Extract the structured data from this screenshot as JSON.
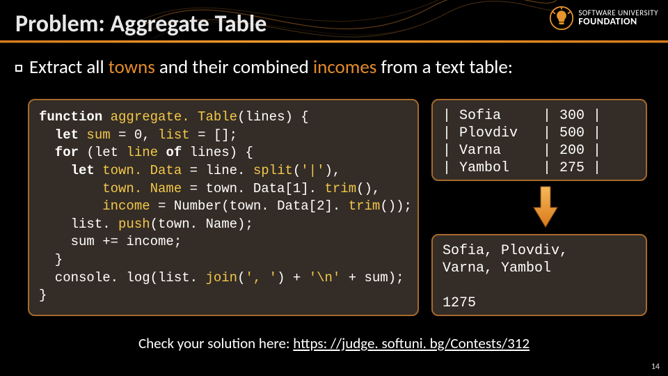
{
  "logo": {
    "line1": "SOFTWARE UNIVERSITY",
    "line2": "FOUNDATION"
  },
  "title": "Problem: Aggregate Table",
  "bullet": {
    "pre": "Extract all ",
    "a1": "towns",
    "mid": " and their combined ",
    "a2": "incomes",
    "post": " from a text table:"
  },
  "code": {
    "l1a": "function ",
    "l1b": "aggregate. Table",
    "l1c": "(lines) {",
    "l2a": "  let ",
    "l2b": "sum ",
    "l2c": "= 0, ",
    "l2d": "list ",
    "l2e": "= [];",
    "l3a": "  for ",
    "l3b": "(let ",
    "l3c": "line ",
    "l3d": "of ",
    "l3e": "lines) {",
    "l4a": "    let ",
    "l4b": "town. Data ",
    "l4c": "= line. ",
    "l4d": "split",
    "l4e": "(",
    "l4f": "'|'",
    "l4g": "),",
    "l5a": "        ",
    "l5b": "town. Name ",
    "l5c": "= town. Data[1]. ",
    "l5d": "trim",
    "l5e": "(),",
    "l6a": "        ",
    "l6b": "income ",
    "l6c": "= Number(town. Data[2]. ",
    "l6d": "trim",
    "l6e": "());",
    "l7a": "    list. ",
    "l7b": "push",
    "l7c": "(town. Name);",
    "l8": "    sum += income;",
    "l9": "  }",
    "l10a": "  console. log(list. ",
    "l10b": "join",
    "l10c": "(",
    "l10d": "', '",
    "l10e": ") + ",
    "l10f": "'\\n' ",
    "l10g": "+ sum);",
    "l11": "}"
  },
  "input": {
    "r1": "| Sofia     | 300 |",
    "r2": "| Plovdiv   | 500 |",
    "r3": "| Varna     | 200 |",
    "r4": "| Yambol    | 275 |"
  },
  "output": {
    "r1": "Sofia, Plovdiv,",
    "r2": "Varna, Yambol",
    "r3": "",
    "r4": "1275"
  },
  "check": {
    "pre": "Check your solution here: ",
    "link": "https: //judge. softuni. bg/Contests/312"
  },
  "page": "14"
}
